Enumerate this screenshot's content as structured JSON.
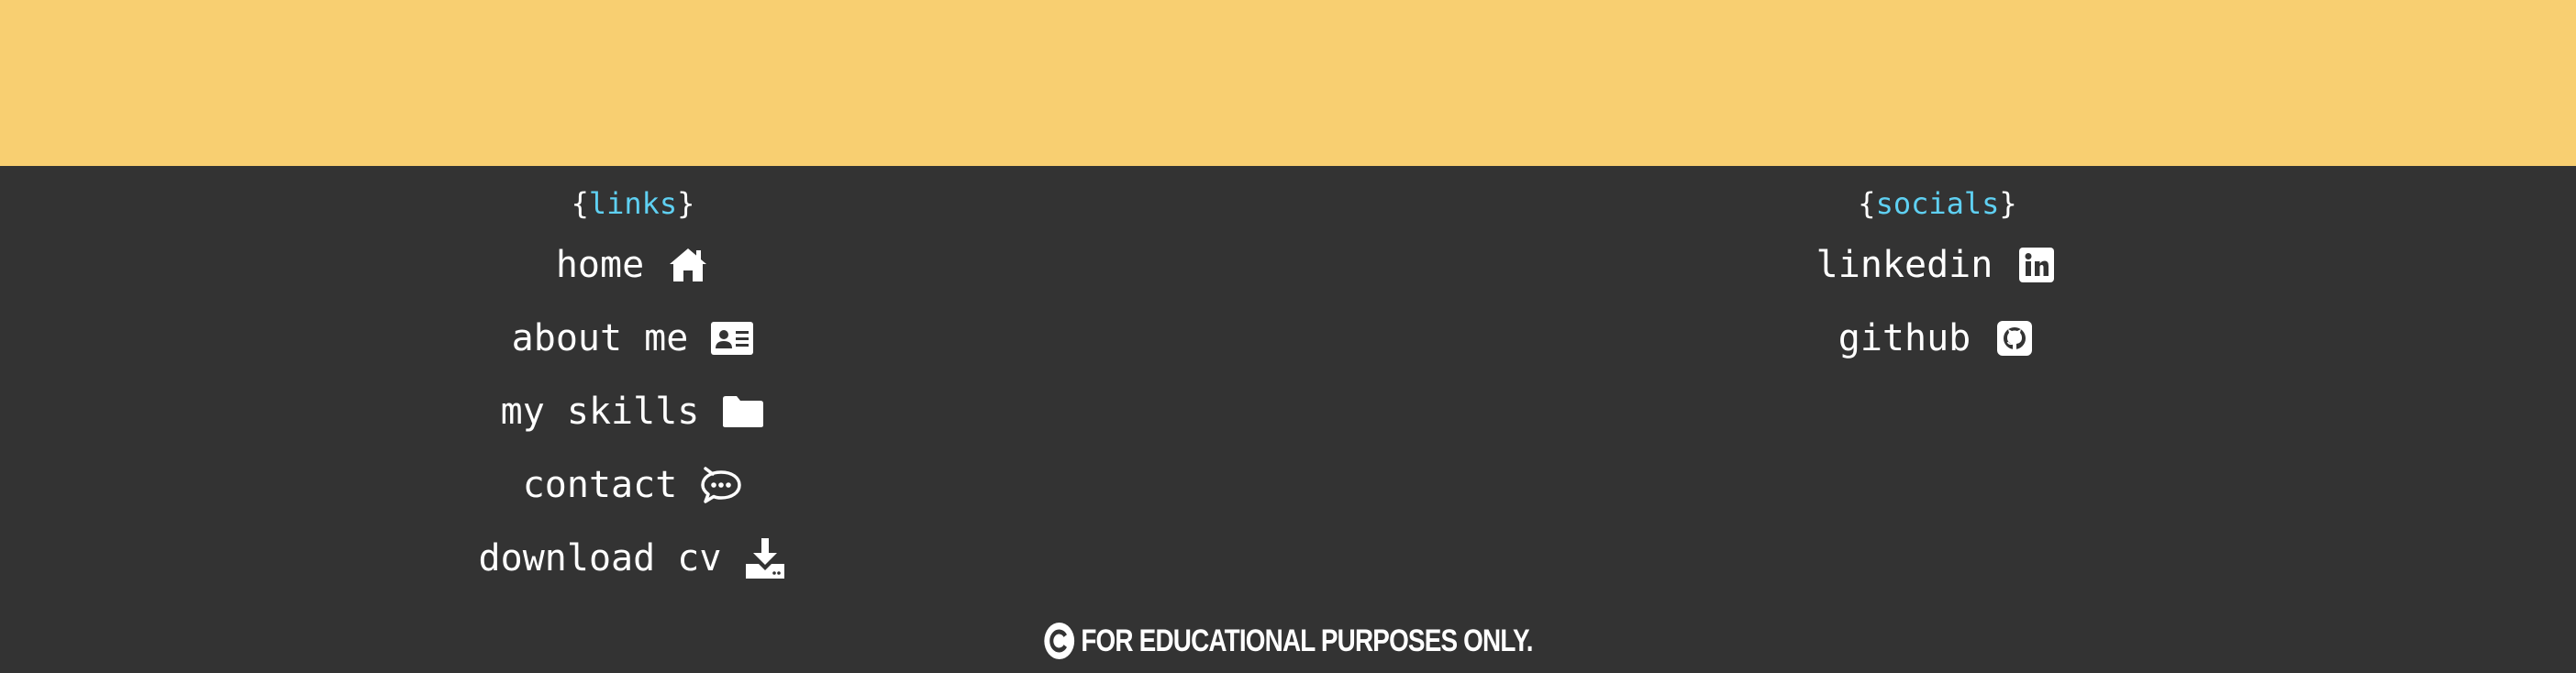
{
  "links": {
    "heading_open": "{",
    "heading_word": "links",
    "heading_close": "}",
    "items": [
      {
        "label": "home",
        "icon": "home-icon"
      },
      {
        "label": "about me",
        "icon": "id-card-icon"
      },
      {
        "label": "my skills",
        "icon": "folder-icon"
      },
      {
        "label": "contact",
        "icon": "chat-bubble-icon"
      },
      {
        "label": "download cv",
        "icon": "download-icon"
      }
    ]
  },
  "socials": {
    "heading_open": "{",
    "heading_word": "socials",
    "heading_close": "}",
    "items": [
      {
        "label": "linkedin",
        "icon": "linkedin-icon"
      },
      {
        "label": "github",
        "icon": "github-icon"
      }
    ]
  },
  "footer": {
    "copyright_text": "FOR EDUCATIONAL PURPOSES ONLY.",
    "copyright_icon": "copyright-icon"
  },
  "colors": {
    "top_band": "#f8cf71",
    "footer_bg": "#333333",
    "accent": "#5fd0f2",
    "text": "#ffffff"
  }
}
